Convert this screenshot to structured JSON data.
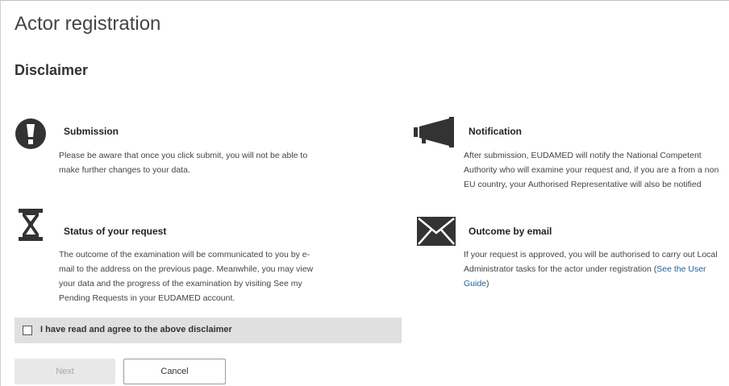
{
  "page": {
    "title": "Actor registration",
    "section_title": "Disclaimer"
  },
  "blocks": {
    "submission": {
      "icon": "exclamation-circle-icon",
      "heading": "Submission",
      "lines": [
        "Please be aware that once you click submit, you will not be able to",
        "make further changes to your data."
      ]
    },
    "notification": {
      "icon": "megaphone-icon",
      "heading": "Notification",
      "lines": [
        "After submission, EUDAMED will notify the National Competent",
        "Authority who will examine your request and, if you are a from a non",
        "EU country, your Authorised Representative will also be notified"
      ]
    },
    "status": {
      "icon": "hourglass-icon",
      "heading": "Status of your request",
      "lines": [
        "The outcome of the examination will be communicated to you by e-",
        "mail to the address on the previous page. Meanwhile, you may view",
        "your data and the progress of the examination by visiting See my",
        "Pending Requests in your EUDAMED account."
      ]
    },
    "outcome": {
      "icon": "envelope-icon",
      "heading": "Outcome by email",
      "line1": "If your request is approved, you will be authorised to carry out Local",
      "line2_text": "Administrator tasks for the actor under registration (",
      "link_part1": "See the User",
      "link_part2": "Guide",
      "line3_tail": ")"
    }
  },
  "agreement": {
    "checked": false,
    "label": "I have read and agree to the above disclaimer"
  },
  "buttons": {
    "next_label": "Next",
    "next_disabled": true,
    "cancel_label": "Cancel"
  },
  "colors": {
    "link": "#1f5f9e",
    "icon": "#333333",
    "bar_background": "#e0e0e0"
  }
}
